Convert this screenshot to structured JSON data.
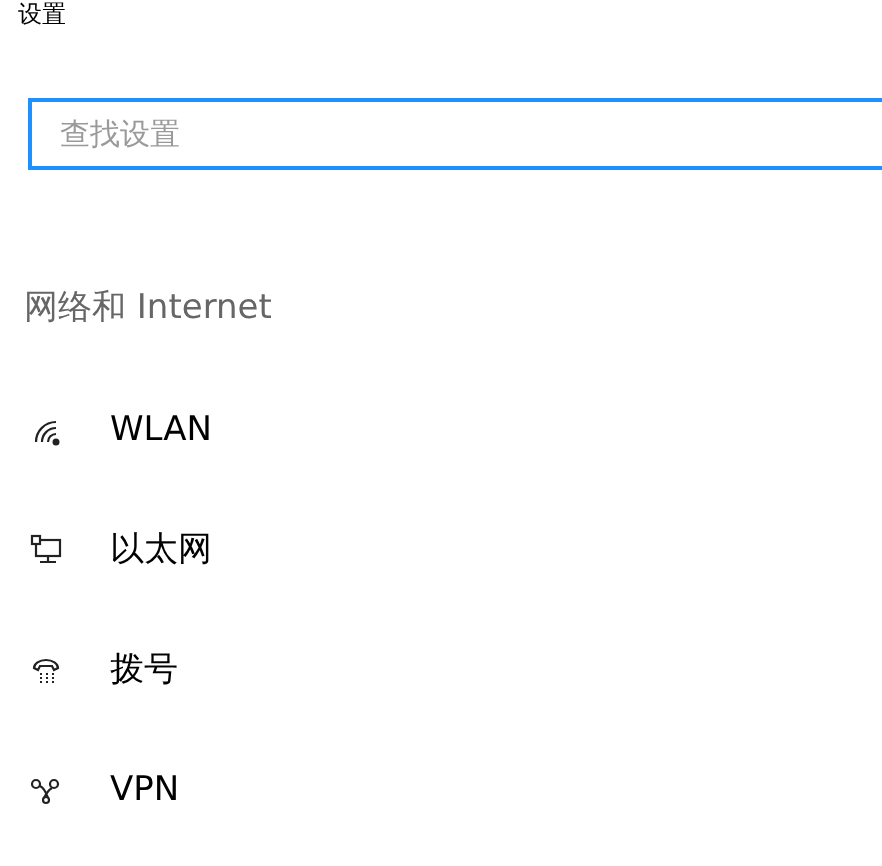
{
  "window": {
    "title": "设置"
  },
  "search": {
    "placeholder": "查找设置"
  },
  "section": {
    "title": "网络和 Internet"
  },
  "items": [
    {
      "label": "WLAN",
      "kind": "wifi"
    },
    {
      "label": "以太网",
      "kind": "ethernet"
    },
    {
      "label": "拨号",
      "kind": "dialup"
    },
    {
      "label": "VPN",
      "kind": "vpn"
    }
  ]
}
